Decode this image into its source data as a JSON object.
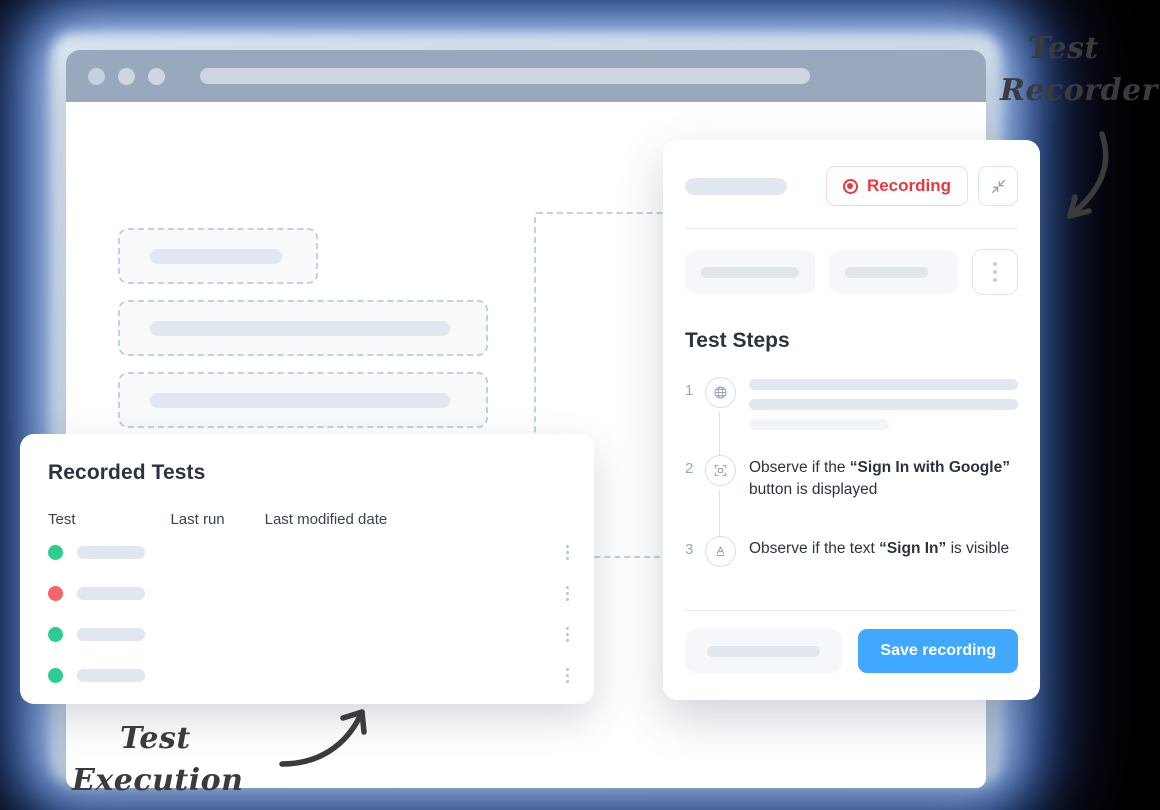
{
  "annotations": {
    "top_right": {
      "line1": "Test",
      "line2": "Recorder",
      "arrow": "curved-arrow-down-left"
    },
    "bottom_left": {
      "line1": "Test",
      "line2": "Execution",
      "arrow": "curved-arrow-up-right"
    }
  },
  "browser": {
    "traffic_lights": [
      "window-dot-1",
      "window-dot-2",
      "window-dot-3"
    ],
    "url_placeholder": "",
    "content_blocks": [
      {
        "name": "placeholder-block-1",
        "state": "normal"
      },
      {
        "name": "placeholder-block-2",
        "state": "normal"
      },
      {
        "name": "placeholder-block-3",
        "state": "normal"
      },
      {
        "name": "placeholder-block-4",
        "state": "error"
      }
    ]
  },
  "recorded_tests": {
    "title": "Recorded Tests",
    "columns": [
      "Test",
      "Last run",
      "Last modified date",
      ""
    ],
    "rows": [
      {
        "status": "passed",
        "status_color": "#2ecc8f"
      },
      {
        "status": "failed",
        "status_color": "#f7636a"
      },
      {
        "status": "passed",
        "status_color": "#2ecc8f"
      },
      {
        "status": "passed",
        "status_color": "#2ecc8f"
      }
    ],
    "row_menu_icon": "kebab-menu-icon"
  },
  "test_recorder": {
    "recording_label": "Recording",
    "recording_color": "#e8383f",
    "collapse_icon": "collapse-arrows-icon",
    "more_icon": "kebab-menu-icon",
    "steps_title": "Test Steps",
    "steps": [
      {
        "number": "1",
        "icon": "globe-icon",
        "text": "",
        "skeleton": true
      },
      {
        "number": "2",
        "icon": "element-target-icon",
        "prefix": "Observe if the ",
        "quoted": "“Sign In with Google”",
        "suffix": " button is displayed"
      },
      {
        "number": "3",
        "icon": "text-underline-icon",
        "prefix": "Observe if the text ",
        "quoted": "“Sign In”",
        "suffix": " is visible"
      }
    ],
    "save_label": "Save recording",
    "save_color": "#40a9ff"
  }
}
